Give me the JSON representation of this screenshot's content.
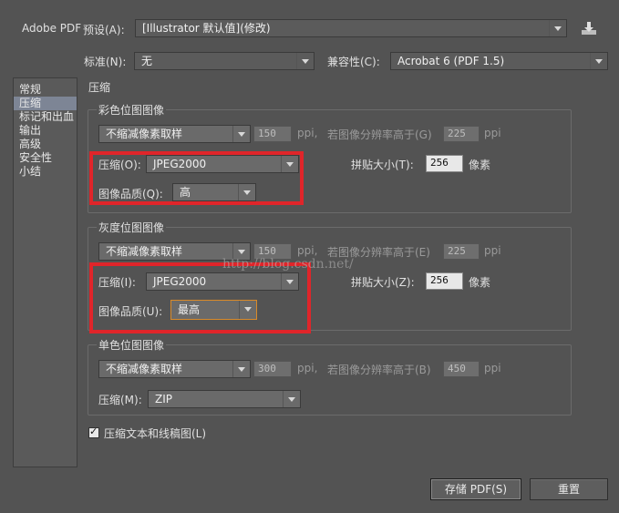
{
  "header": {
    "app_label": "Adobe PDF",
    "preset_label": "预设(A):",
    "preset_value": "[Illustrator 默认值](修改)",
    "standard_label": "标准(N):",
    "standard_value": "无",
    "compat_label": "兼容性(C):",
    "compat_value": "Acrobat 6 (PDF 1.5)"
  },
  "sidebar": {
    "items": [
      {
        "label": "常规"
      },
      {
        "label": "压缩"
      },
      {
        "label": "标记和出血"
      },
      {
        "label": "输出"
      },
      {
        "label": "高级"
      },
      {
        "label": "安全性"
      },
      {
        "label": "小结"
      }
    ],
    "selected_index": 1
  },
  "panel": {
    "title": "压缩"
  },
  "color": {
    "title": "彩色位图图像",
    "resample_value": "不缩减像素取样",
    "ppi_value": "150",
    "ppi_unit": "ppi",
    "threshold_label": "若图像分辨率高于(G)",
    "threshold_value": "225",
    "threshold_unit": "ppi",
    "compression_label": "压缩(O):",
    "compression_value": "JPEG2000",
    "tile_label": "拼贴大小(T):",
    "tile_value": "256",
    "tile_unit": "像素",
    "quality_label": "图像品质(Q):",
    "quality_value": "高"
  },
  "gray": {
    "title": "灰度位图图像",
    "resample_value": "不缩减像素取样",
    "ppi_value": "150",
    "ppi_unit": "ppi",
    "threshold_label": "若图像分辨率高于(E)",
    "threshold_value": "225",
    "threshold_unit": "ppi",
    "compression_label": "压缩(I):",
    "compression_value": "JPEG2000",
    "tile_label": "拼贴大小(Z):",
    "tile_value": "256",
    "tile_unit": "像素",
    "quality_label": "图像品质(U):",
    "quality_value": "最高"
  },
  "mono": {
    "title": "单色位图图像",
    "resample_value": "不缩减像素取样",
    "ppi_value": "300",
    "ppi_unit": "ppi",
    "threshold_label": "若图像分辨率高于(B)",
    "threshold_value": "450",
    "threshold_unit": "ppi",
    "compression_label": "压缩(M):",
    "compression_value": "ZIP"
  },
  "compress_text_label": "压缩文本和线稿图(L)",
  "compress_text_checked": true,
  "buttons": {
    "save": "存储 PDF(S)",
    "reset": "重置"
  },
  "watermark": "http://blog.csdn.net/",
  "colors": {
    "highlight_box": "#e0252a",
    "background": "#535353",
    "sidebar_selected": "#7d8595"
  },
  "icons": {
    "save_preset": "download-tray-icon",
    "dropdown": "chevron-down-icon"
  }
}
